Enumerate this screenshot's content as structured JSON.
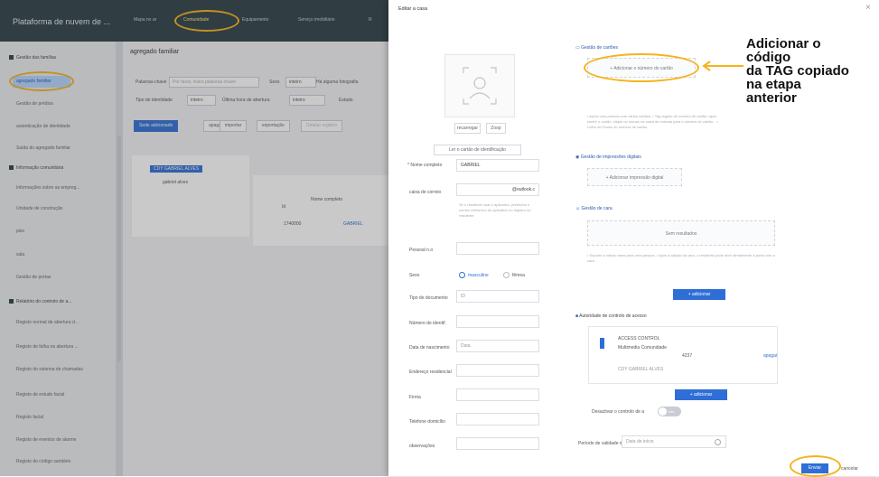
{
  "topbar": {
    "brand": "Plataforma de nuvem de ...",
    "nav": [
      "Mapa no ar",
      "Comunidade",
      "Equipamento",
      "Serviço imobiliário",
      "R"
    ]
  },
  "sidebar": {
    "group1": "Gestão das famílias",
    "items1": [
      "agregado familiar",
      "Gestão de prédios",
      "autenticação de identidade",
      "Saída do agregado familiar"
    ],
    "group2": "Informação comunitária",
    "items2": [
      "Informações sobre as empreg...",
      "Unidade de construção",
      "piso",
      "sala",
      "Gestão de portas"
    ],
    "group3": "Relatório do controlo de a...",
    "items3": [
      "Registo normal de abertura d...",
      "Registo de falha na abertura ...",
      "Registo do sistema de chamadas",
      "Registo de estudo facial",
      "Registo facial",
      "Registo de eventos de alarme",
      "Registo do código sanitário"
    ]
  },
  "main": {
    "title": "agregado familiar",
    "row1_labels": [
      "Palavras-chave",
      "Sexo",
      "Há alguma fotografia"
    ],
    "row1_placeholder": "Por favor, insira palavras-chave",
    "row1_sexo_value": "inteiro",
    "row2_labels": [
      "Tipo de identidade",
      "Última hora de abertura",
      "Estado"
    ],
    "row2_values": [
      "inteiro",
      "inteiro"
    ],
    "buttons": [
      "Sede adicionado",
      "apagar",
      "importar",
      "exportação",
      "Deletar registro"
    ],
    "tree_root": "CDY GABRIEL ALVES",
    "tree_child": "gabriel alves",
    "table_headers": [
      "Id",
      "Nome completo"
    ],
    "table_row": [
      "1740000",
      "GABRIEL"
    ]
  },
  "modal": {
    "title": "Editar a casa",
    "close": "×",
    "photo_buttons": [
      "recarregar",
      "Zoop"
    ],
    "read_card_button": "Ler o cartão de identificação",
    "fields": [
      {
        "label": "* Nome completo",
        "value": "GABRIEL"
      },
      {
        "label": "caixa de correio",
        "value": "@outlook.c"
      },
      {
        "label": "Pessoal n.o",
        "value": ""
      },
      {
        "label": "Sexo",
        "value": ""
      },
      {
        "label": "Tipo de documento",
        "value": "ID"
      },
      {
        "label": "Número de identif.",
        "value": ""
      },
      {
        "label": "Data de nascimento",
        "value": "Data"
      },
      {
        "label": "Endereço residencial",
        "value": ""
      },
      {
        "label": "Firma",
        "value": ""
      },
      {
        "label": "Telefone domicílio",
        "value": ""
      },
      {
        "label": "observações",
        "value": ""
      }
    ],
    "email_hint": "Se o residente usar o aplicativo, preencha o correio eletrônico do aplicativo no registro do residente",
    "sex_options": [
      "masculino",
      "fêmea"
    ],
    "card_section": "Gestão de cartões",
    "card_add": "+ Adicionar o número do cartão",
    "card_notes": "• Apoia uma pessoa com vários cartões. • Tag registo de número de cartão: após inserir o cartão, clique no mouse na caixa de entrada para o número de cartão... • Leitor de Hooks do número de cartão.",
    "fingerprint_section": "Gestão de impressões digitais",
    "fingerprint_add": "+ Adicionar impressão digital",
    "face_section": "Gestão de cara",
    "face_placeholder": "Sem resultados",
    "face_notes": "• Suporte a várias caras para uma pessoa. • Após a adição da cara, o residente pode abrir diretamente a porta com a cara.",
    "add_button": "adicionar",
    "access_section": "Autoridade de controlo de acesso",
    "access_card": {
      "title": "ACCESS CONTROL",
      "line2": "Multimedia Comunidade",
      "number": "4237",
      "owner": "CDY GABRIEL ALVES",
      "remove": "apagar"
    },
    "access_toggle_label": "Desactivar o controlo de a",
    "access_toggle_value": "não",
    "validity_label": "Período de validade d",
    "validity_placeholder": "Data de início",
    "submit": "Enviar",
    "cancel": "cancelar"
  },
  "annotation": {
    "text": [
      "Adicionar o",
      "código",
      "da TAG copiado",
      "na etapa",
      "anterior"
    ],
    "color": "#f6b21b"
  }
}
